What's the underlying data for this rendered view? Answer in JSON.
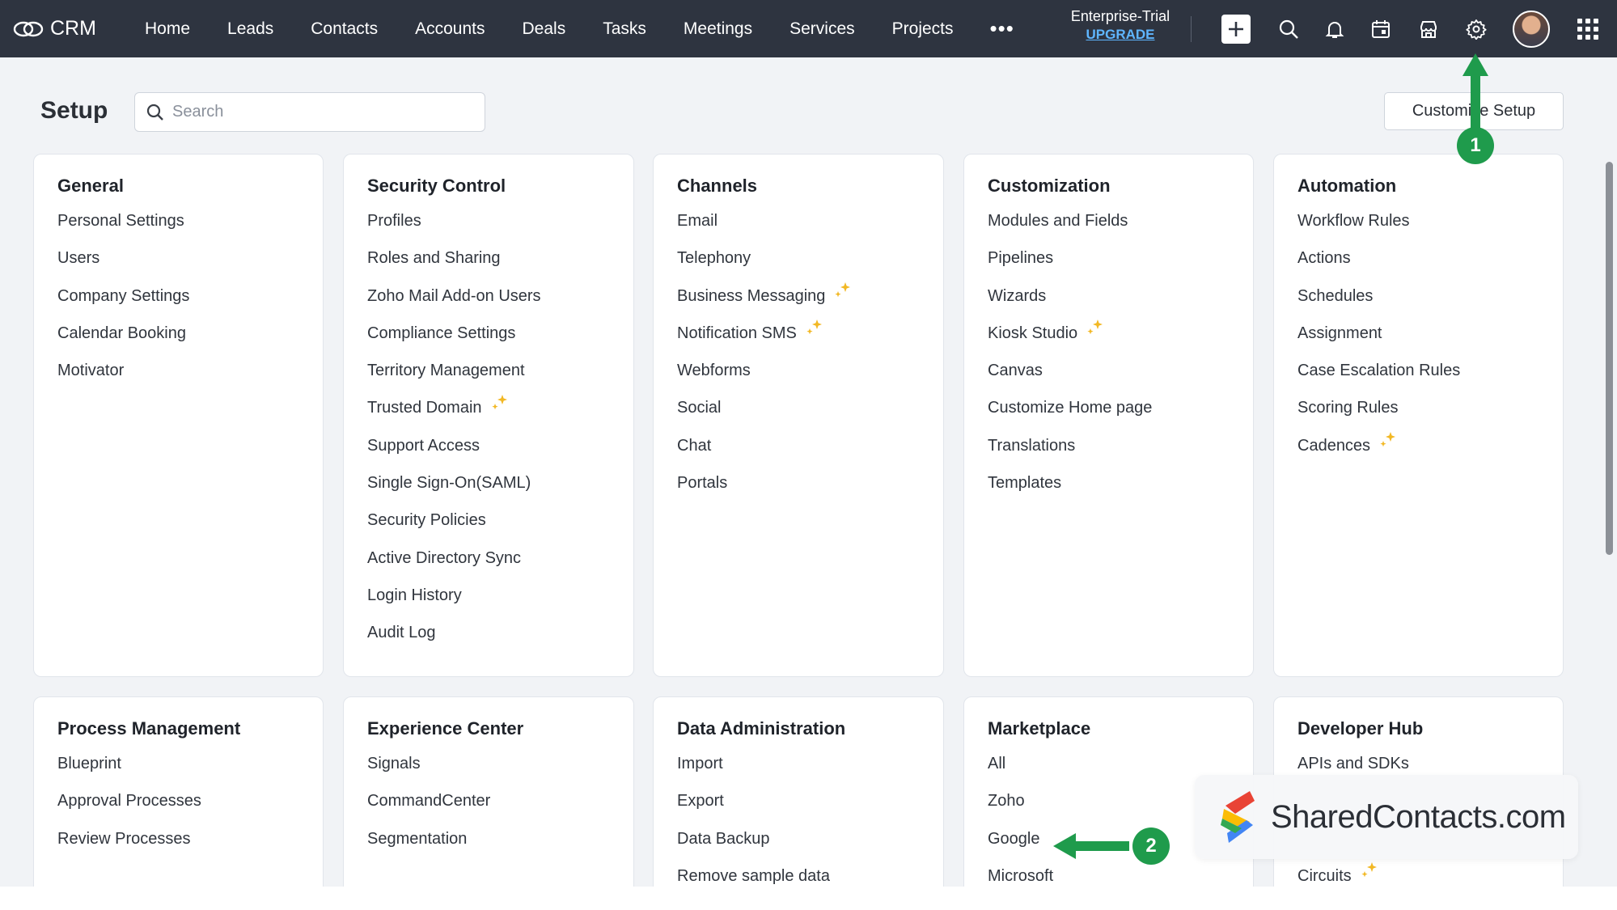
{
  "brand": {
    "name": "CRM"
  },
  "nav": {
    "items": [
      "Home",
      "Leads",
      "Contacts",
      "Accounts",
      "Deals",
      "Tasks",
      "Meetings",
      "Services",
      "Projects"
    ],
    "more": "•••"
  },
  "plan": {
    "name": "Enterprise-Trial",
    "upgrade": "UPGRADE"
  },
  "page": {
    "title": "Setup"
  },
  "search": {
    "placeholder": "Search"
  },
  "customize_button": "Customize Setup",
  "cards": [
    {
      "title": "General",
      "items": [
        {
          "label": "Personal Settings"
        },
        {
          "label": "Users"
        },
        {
          "label": "Company Settings"
        },
        {
          "label": "Calendar Booking"
        },
        {
          "label": "Motivator"
        }
      ]
    },
    {
      "title": "Security Control",
      "items": [
        {
          "label": "Profiles"
        },
        {
          "label": "Roles and Sharing"
        },
        {
          "label": "Zoho Mail Add-on Users"
        },
        {
          "label": "Compliance Settings"
        },
        {
          "label": "Territory Management"
        },
        {
          "label": "Trusted Domain",
          "new": true
        },
        {
          "label": "Support Access"
        },
        {
          "label": "Single Sign-On(SAML)"
        },
        {
          "label": "Security Policies"
        },
        {
          "label": "Active Directory Sync"
        },
        {
          "label": "Login History"
        },
        {
          "label": "Audit Log"
        }
      ]
    },
    {
      "title": "Channels",
      "items": [
        {
          "label": "Email"
        },
        {
          "label": "Telephony"
        },
        {
          "label": "Business Messaging",
          "new": true
        },
        {
          "label": "Notification SMS",
          "new": true
        },
        {
          "label": "Webforms"
        },
        {
          "label": "Social"
        },
        {
          "label": "Chat"
        },
        {
          "label": "Portals"
        }
      ]
    },
    {
      "title": "Customization",
      "items": [
        {
          "label": "Modules and Fields"
        },
        {
          "label": "Pipelines"
        },
        {
          "label": "Wizards"
        },
        {
          "label": "Kiosk Studio",
          "new": true
        },
        {
          "label": "Canvas"
        },
        {
          "label": "Customize Home page"
        },
        {
          "label": "Translations"
        },
        {
          "label": "Templates"
        }
      ]
    },
    {
      "title": "Automation",
      "items": [
        {
          "label": "Workflow Rules"
        },
        {
          "label": "Actions"
        },
        {
          "label": "Schedules"
        },
        {
          "label": "Assignment"
        },
        {
          "label": "Case Escalation Rules"
        },
        {
          "label": "Scoring Rules"
        },
        {
          "label": "Cadences",
          "new": true
        }
      ]
    },
    {
      "title": "Process Management",
      "items": [
        {
          "label": "Blueprint"
        },
        {
          "label": "Approval Processes"
        },
        {
          "label": "Review Processes"
        }
      ]
    },
    {
      "title": "Experience Center",
      "items": [
        {
          "label": "Signals"
        },
        {
          "label": "CommandCenter"
        },
        {
          "label": "Segmentation"
        }
      ]
    },
    {
      "title": "Data Administration",
      "items": [
        {
          "label": "Import"
        },
        {
          "label": "Export"
        },
        {
          "label": "Data Backup"
        },
        {
          "label": "Remove sample data"
        }
      ]
    },
    {
      "title": "Marketplace",
      "items": [
        {
          "label": "All"
        },
        {
          "label": "Zoho"
        },
        {
          "label": "Google"
        },
        {
          "label": "Microsoft"
        }
      ]
    },
    {
      "title": "Developer Hub",
      "items": [
        {
          "label": "APIs and SDKs"
        },
        {
          "label": ""
        },
        {
          "label": ""
        },
        {
          "label": "Circuits",
          "new": true
        }
      ]
    }
  ],
  "annotations": [
    {
      "number": "1",
      "color": "#1f9b4c"
    },
    {
      "number": "2",
      "color": "#1f9b4c"
    }
  ],
  "watermark": {
    "text": "SharedContacts.com"
  },
  "icons": [
    "crm-logo-icon",
    "add-icon",
    "search-icon",
    "bell-icon",
    "calendar-icon",
    "marketplace-icon",
    "gear-icon",
    "apps-grid-icon",
    "sparkle-icon"
  ],
  "colors": {
    "topbar": "#2e3440",
    "accent_green": "#1f9b4c",
    "link_blue": "#5fb6ff",
    "sparkle": "#f2b824"
  }
}
